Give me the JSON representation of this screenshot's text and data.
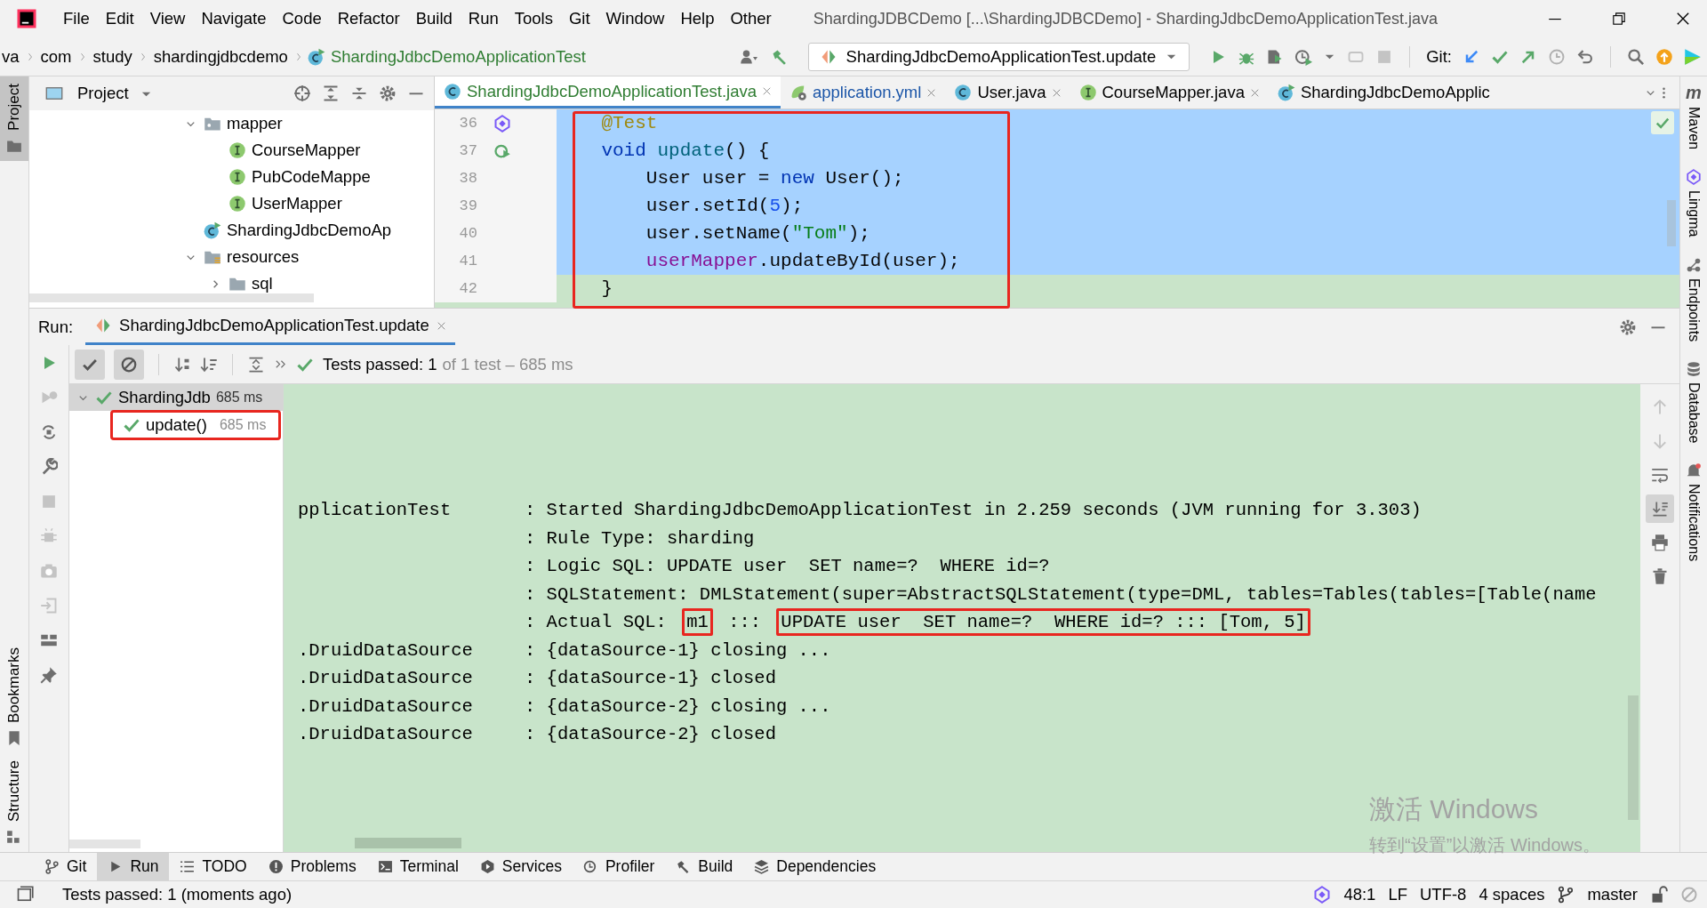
{
  "window": {
    "title": "ShardingJDBCDemo [...\\ShardingJDBCDemo] - ShardingJdbcDemoApplicationTest.java"
  },
  "menu": [
    "File",
    "Edit",
    "View",
    "Navigate",
    "Code",
    "Refactor",
    "Build",
    "Run",
    "Tools",
    "Git",
    "Window",
    "Help",
    "Other"
  ],
  "breadcrumbs": [
    {
      "label": "va",
      "kind": "plain"
    },
    {
      "label": "com",
      "kind": "plain"
    },
    {
      "label": "study",
      "kind": "plain"
    },
    {
      "label": "shardingjdbcdemo",
      "kind": "plain"
    },
    {
      "label": "ShardingJdbcDemoApplicationTest",
      "kind": "class"
    }
  ],
  "run_config": {
    "label": "ShardingJdbcDemoApplicationTest.update"
  },
  "vcs_label": "Git:",
  "left_stripe_top": [
    {
      "label": "Project",
      "selected": true
    }
  ],
  "left_stripe_bottom": [
    {
      "label": "Bookmarks",
      "selected": false
    },
    {
      "label": "Structure",
      "selected": false
    }
  ],
  "right_stripe": [
    {
      "label": "Maven",
      "kind": "maven",
      "glyph": "m"
    },
    {
      "label": "Lingma",
      "kind": "lingma"
    },
    {
      "label": "Endpoints",
      "kind": "endpoints"
    },
    {
      "label": "Database",
      "kind": "database"
    },
    {
      "label": "Notifications",
      "kind": "notifications"
    }
  ],
  "project_panel": {
    "title": "Project",
    "tree": [
      {
        "label": "mapper",
        "kind": "package",
        "expanded": true,
        "children": [
          {
            "label": "CourseMapper",
            "kind": "interface"
          },
          {
            "label": "PubCodeMappe",
            "kind": "interface"
          },
          {
            "label": "UserMapper",
            "kind": "interface"
          }
        ]
      },
      {
        "label": "ShardingJdbcDemoAp",
        "kind": "app-class"
      },
      {
        "label": "resources",
        "kind": "resource-root",
        "expanded": true,
        "children": [
          {
            "label": "sql",
            "kind": "folder",
            "expanded": false
          }
        ]
      }
    ]
  },
  "editor_tabs": [
    {
      "label": "ShardingJdbcDemoApplicationTest.java",
      "kind": "class",
      "selected": true,
      "color": "#2f7d32"
    },
    {
      "label": "application.yml",
      "kind": "yml",
      "selected": false,
      "color": "#1c56a8"
    },
    {
      "label": "User.java",
      "kind": "class",
      "selected": false,
      "color": "#000000"
    },
    {
      "label": "CourseMapper.java",
      "kind": "interface",
      "selected": false,
      "color": "#000000"
    },
    {
      "label": "ShardingJdbcDemoApplic",
      "kind": "app-class",
      "selected": false,
      "color": "#000000"
    }
  ],
  "editor": {
    "highlighted": true,
    "lines": [
      {
        "number": "36",
        "selected": true,
        "gutter": {
          "kind": "lingma"
        },
        "tokens": [
          {
            "text": "    @Test",
            "kind": "annotation"
          }
        ]
      },
      {
        "number": "37",
        "selected": true,
        "gutter": {
          "kind": "run"
        },
        "tokens": [
          {
            "text": "    void",
            "kind": "keyword"
          },
          {
            "text": " update",
            "kind": "method"
          },
          {
            "text": "() {",
            "kind": "plain"
          }
        ]
      },
      {
        "number": "38",
        "selected": true,
        "tokens": [
          {
            "text": "        User user = ",
            "kind": "plain"
          },
          {
            "text": "new",
            "kind": "keyword"
          },
          {
            "text": " User();",
            "kind": "plain"
          }
        ]
      },
      {
        "number": "39",
        "selected": true,
        "tokens": [
          {
            "text": "        user.setId(",
            "kind": "plain"
          },
          {
            "text": "5",
            "kind": "number"
          },
          {
            "text": ");",
            "kind": "plain"
          }
        ]
      },
      {
        "number": "40",
        "selected": true,
        "tokens": [
          {
            "text": "        user.setName(",
            "kind": "plain"
          },
          {
            "text": "\"Tom\"",
            "kind": "string"
          },
          {
            "text": ");",
            "kind": "plain"
          }
        ]
      },
      {
        "number": "41",
        "selected": true,
        "tokens": [
          {
            "text": "        userMapper",
            "kind": "field"
          },
          {
            "text": ".updateById(user);",
            "kind": "plain"
          }
        ]
      },
      {
        "number": "42",
        "selected": false,
        "tokens": [
          {
            "text": "    }",
            "kind": "plain"
          }
        ]
      }
    ]
  },
  "run_panel": {
    "label": "Run:",
    "tab": {
      "label": "ShardingJdbcDemoApplicationTest.update",
      "selected": true
    },
    "filters": [
      {
        "kind": "passed",
        "on": true
      },
      {
        "kind": "ignored",
        "on": true
      }
    ],
    "status_passed": "Tests passed: 1",
    "status_detail": "of 1 test – 685 ms",
    "test_tree": [
      {
        "label": "ShardingJdb",
        "duration": "685 ms",
        "passed": true,
        "expanded": true,
        "selected": true,
        "highlighted": false,
        "children": [
          {
            "label": "update()",
            "duration": "685 ms",
            "passed": true,
            "selected": false,
            "highlighted": true
          }
        ]
      }
    ],
    "console": [
      {
        "source": "pplicationTest",
        "parts": [
          {
            "text": ": Started ShardingJdbcDemoApplicationTest in 2.259 seconds (JVM running for 3.303)",
            "highlighted": false
          }
        ]
      },
      {
        "parts": [
          {
            "text": ": Rule Type: sharding",
            "highlighted": false
          }
        ]
      },
      {
        "parts": [
          {
            "text": ": Logic SQL: UPDATE user  SET name=?  WHERE id=?",
            "highlighted": false
          }
        ]
      },
      {
        "parts": [
          {
            "text": ": SQLStatement: DMLStatement(super=AbstractSQLStatement(type=DML, tables=Tables(tables=[Table(name",
            "highlighted": false
          }
        ]
      },
      {
        "parts": [
          {
            "text": ": Actual SQL: ",
            "highlighted": false
          },
          {
            "text": "m1",
            "highlighted": true
          },
          {
            "text": " ::: ",
            "highlighted": false
          },
          {
            "text": "UPDATE user  SET name=?  WHERE id=? ::: [Tom, 5]",
            "highlighted": true
          }
        ]
      },
      {
        "source": ".DruidDataSource",
        "parts": [
          {
            "text": ": {dataSource-1} closing ...",
            "highlighted": false
          }
        ]
      },
      {
        "source": ".DruidDataSource",
        "parts": [
          {
            "text": ": {dataSource-1} closed",
            "highlighted": false
          }
        ]
      },
      {
        "source": ".DruidDataSource",
        "parts": [
          {
            "text": ": {dataSource-2} closing ...",
            "highlighted": false
          }
        ]
      },
      {
        "source": ".DruidDataSource",
        "parts": [
          {
            "text": ": {dataSource-2} closed",
            "highlighted": false
          }
        ]
      }
    ]
  },
  "tool_window_tabs": [
    {
      "label": "Git",
      "kind": "git",
      "selected": false
    },
    {
      "label": "Run",
      "kind": "run",
      "selected": true
    },
    {
      "label": "TODO",
      "kind": "todo",
      "selected": false
    },
    {
      "label": "Problems",
      "kind": "problems",
      "selected": false
    },
    {
      "label": "Terminal",
      "kind": "terminal",
      "selected": false
    },
    {
      "label": "Services",
      "kind": "services",
      "selected": false
    },
    {
      "label": "Profiler",
      "kind": "profiler",
      "selected": false
    },
    {
      "label": "Build",
      "kind": "build",
      "selected": false
    },
    {
      "label": "Dependencies",
      "kind": "dependencies",
      "selected": false
    }
  ],
  "status_bar": {
    "message": "Tests passed: 1 (moments ago)",
    "position": "48:1",
    "line_separator": "LF",
    "encoding": "UTF-8",
    "indent": "4 spaces",
    "branch": "master"
  },
  "os_activation_notice": {
    "title": "激活 Windows",
    "text": "转到“设置”以激活 Windows。"
  }
}
